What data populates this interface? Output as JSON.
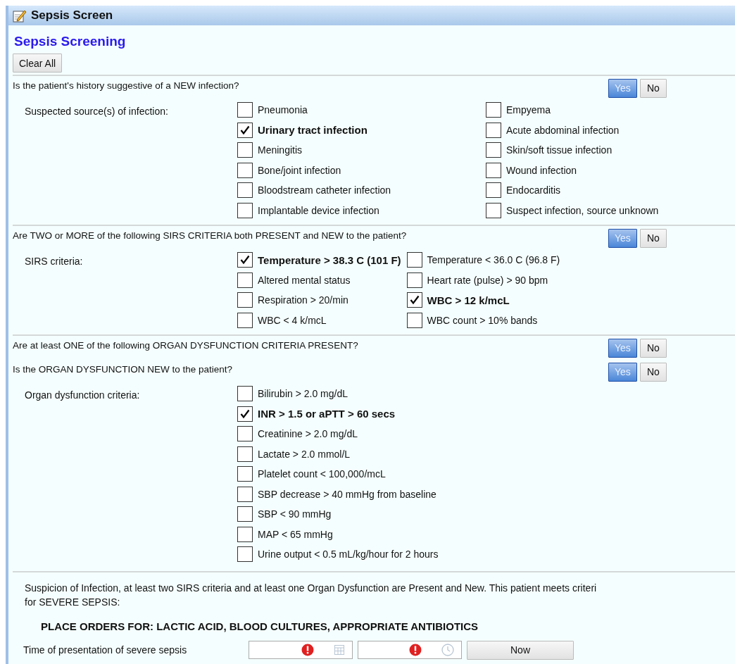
{
  "window": {
    "title": "Sepsis Screen"
  },
  "heading": "Sepsis Screening",
  "clear_button": "Clear All",
  "sections": [
    {
      "questions": [
        {
          "text": "Is the patient's history suggestive of a NEW infection?",
          "buttons": [
            {
              "label": "Yes",
              "selected": true
            },
            {
              "label": "No",
              "selected": false
            }
          ]
        }
      ],
      "criteria": {
        "label": "Suspected source(s) of infection:",
        "items": [
          {
            "label": "Pneumonia",
            "checked": false
          },
          {
            "label": "Empyema",
            "checked": false
          },
          {
            "label": "Urinary tract infection",
            "checked": true
          },
          {
            "label": "Acute abdominal infection",
            "checked": false
          },
          {
            "label": "Meningitis",
            "checked": false
          },
          {
            "label": "Skin/soft tissue infection",
            "checked": false
          },
          {
            "label": "Bone/joint infection",
            "checked": false
          },
          {
            "label": "Wound infection",
            "checked": false
          },
          {
            "label": "Bloodstream catheter infection",
            "checked": false
          },
          {
            "label": "Endocarditis",
            "checked": false
          },
          {
            "label": "Implantable device infection",
            "checked": false
          },
          {
            "label": "Suspect infection, source unknown",
            "checked": false
          }
        ]
      }
    },
    {
      "questions": [
        {
          "text": "Are TWO or MORE of the following SIRS CRITERIA both PRESENT and NEW to the patient?",
          "buttons": [
            {
              "label": "Yes",
              "selected": true
            },
            {
              "label": "No",
              "selected": false
            }
          ]
        }
      ],
      "criteria": {
        "label": "SIRS criteria:",
        "items": [
          {
            "label": "Temperature > 38.3 C (101 F)",
            "checked": true
          },
          {
            "label": "Temperature < 36.0 C (96.8 F)",
            "checked": false
          },
          {
            "label": "Altered mental status",
            "checked": false
          },
          {
            "label": "Heart rate (pulse) > 90 bpm",
            "checked": false
          },
          {
            "label": "Respiration > 20/min",
            "checked": false
          },
          {
            "label": "WBC > 12 k/mcL",
            "checked": true
          },
          {
            "label": "WBC < 4 k/mcL",
            "checked": false
          },
          {
            "label": "WBC count > 10% bands",
            "checked": false
          }
        ]
      }
    },
    {
      "questions": [
        {
          "text": "Are at least ONE of the following ORGAN DYSFUNCTION CRITERIA PRESENT?",
          "buttons": [
            {
              "label": "Yes",
              "selected": true
            },
            {
              "label": "No",
              "selected": false
            }
          ]
        },
        {
          "text": "Is the ORGAN DYSFUNCTION NEW to the patient?",
          "buttons": [
            {
              "label": "Yes",
              "selected": true
            },
            {
              "label": "No",
              "selected": false
            }
          ]
        }
      ],
      "criteria": {
        "label": "Organ dysfunction criteria:",
        "items": [
          {
            "label": "Bilirubin > 2.0 mg/dL",
            "checked": false
          },
          {
            "label": "INR > 1.5 or aPTT > 60 secs",
            "checked": true
          },
          {
            "label": "Creatinine > 2.0 mg/dL",
            "checked": false
          },
          {
            "label": "Lactate > 2.0 mmol/L",
            "checked": false
          },
          {
            "label": "Platelet count < 100,000/mcL",
            "checked": false
          },
          {
            "label": "SBP decrease > 40 mmHg from baseline",
            "checked": false
          },
          {
            "label": "SBP < 90 mmHg",
            "checked": false
          },
          {
            "label": "MAP < 65 mmHg",
            "checked": false
          },
          {
            "label": "Urine output < 0.5 mL/kg/hour for 2 hours",
            "checked": false
          }
        ]
      }
    }
  ],
  "message": {
    "lines": [
      "Suspicion of Infection, at least two SIRS criteria and at least one Organ Dysfunction are Present and New.  This patient meets criteri",
      "for SEVERE SEPSIS:"
    ]
  },
  "orders": "PLACE ORDERS FOR:  LACTIC ACID, BLOOD CULTURES, APPROPRIATE ANTIBIOTICS",
  "time_row": {
    "label": "Time of presentation of severe sepsis",
    "now_button": "Now"
  }
}
